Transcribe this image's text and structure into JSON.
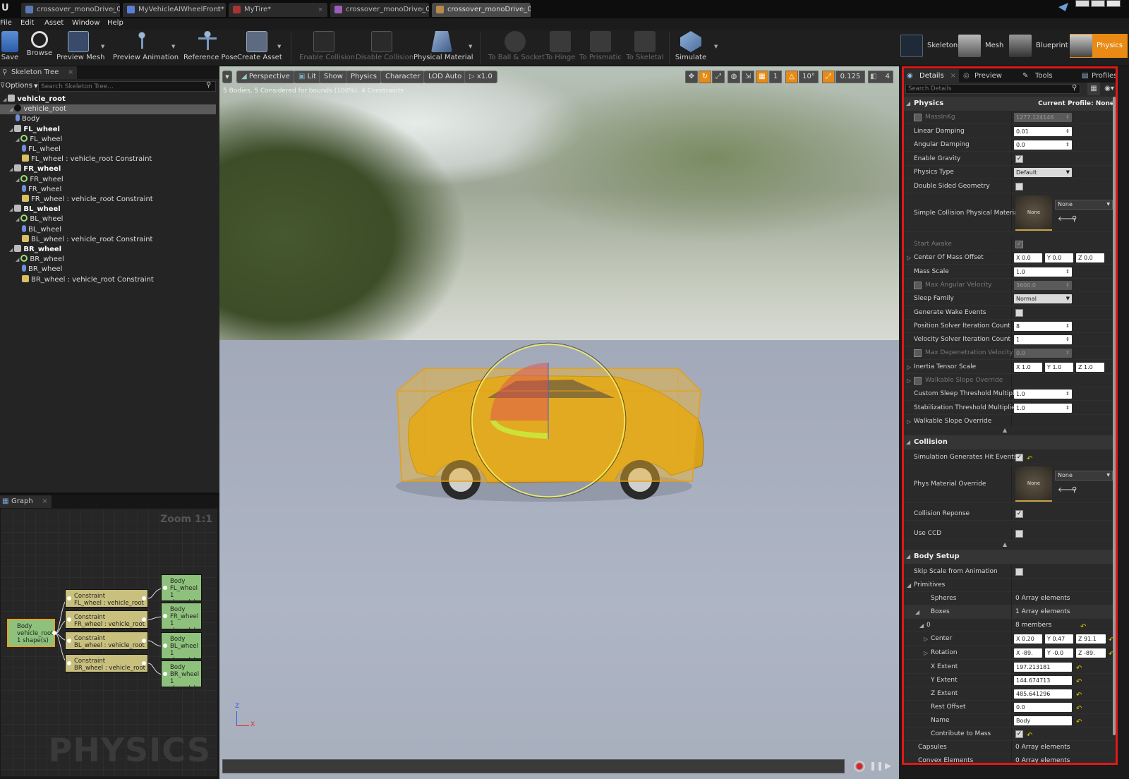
{
  "tabs": [
    {
      "label": "crossover_monoDrive_01",
      "color": "#5a7ab5"
    },
    {
      "label": "MyVehicleAIWheelFront*",
      "color": "#5b7fd8"
    },
    {
      "label": "MyTire*",
      "color": "#a33"
    },
    {
      "label": "crossover_monoDrive_01",
      "color": "#9b5fb5"
    },
    {
      "label": "crossover_monoDrive_01*",
      "color": "#b58a4a"
    }
  ],
  "menu": [
    "File",
    "Edit",
    "Asset",
    "Window",
    "Help"
  ],
  "toolbar": {
    "save": "Save",
    "browse": "Browse",
    "preview_mesh": "Preview Mesh",
    "preview_animation": "Preview Animation",
    "reference_pose": "Reference Pose",
    "create_asset": "Create Asset",
    "enable_collision": "Enable Collision",
    "disable_collision": "Disable Collision",
    "physical_material": "Physical Material",
    "to_ball_socket": "To Ball & Socket",
    "to_hinge": "To Hinge",
    "to_prismatic": "To Prismatic",
    "to_skeletal": "To Skeletal",
    "simulate": "Simulate"
  },
  "modes": {
    "skeleton": "Skeleton",
    "mesh": "Mesh",
    "blueprint": "Blueprint",
    "physics": "Physics"
  },
  "skeleton_tree": {
    "tab": "Skeleton Tree",
    "options": "Options",
    "search_placeholder": "Search Skeleton Tree...",
    "rows": [
      {
        "label": "vehicle_root",
        "indent": 0,
        "bold": true,
        "icon": "bone-icon"
      },
      {
        "label": "vehicle_root",
        "indent": 1,
        "bold": false,
        "icon": "body-icon",
        "selected": true
      },
      {
        "label": "Body",
        "indent": 2,
        "bold": false,
        "icon": "capsule-icon"
      },
      {
        "label": "FL_wheel",
        "indent": 1,
        "bold": true,
        "icon": "bone-icon"
      },
      {
        "label": "FL_wheel",
        "indent": 2,
        "bold": false,
        "icon": "body-icon"
      },
      {
        "label": "FL_wheel",
        "indent": 3,
        "bold": false,
        "icon": "capsule-icon"
      },
      {
        "label": "FL_wheel : vehicle_root Constraint",
        "indent": 3,
        "bold": false,
        "icon": "constraint-icon"
      },
      {
        "label": "FR_wheel",
        "indent": 1,
        "bold": true,
        "icon": "bone-icon"
      },
      {
        "label": "FR_wheel",
        "indent": 2,
        "bold": false,
        "icon": "body-icon"
      },
      {
        "label": "FR_wheel",
        "indent": 3,
        "bold": false,
        "icon": "capsule-icon"
      },
      {
        "label": "FR_wheel : vehicle_root Constraint",
        "indent": 3,
        "bold": false,
        "icon": "constraint-icon"
      },
      {
        "label": "BL_wheel",
        "indent": 1,
        "bold": true,
        "icon": "bone-icon"
      },
      {
        "label": "BL_wheel",
        "indent": 2,
        "bold": false,
        "icon": "body-icon"
      },
      {
        "label": "BL_wheel",
        "indent": 3,
        "bold": false,
        "icon": "capsule-icon"
      },
      {
        "label": "BL_wheel : vehicle_root Constraint",
        "indent": 3,
        "bold": false,
        "icon": "constraint-icon"
      },
      {
        "label": "BR_wheel",
        "indent": 1,
        "bold": true,
        "icon": "bone-icon"
      },
      {
        "label": "BR_wheel",
        "indent": 2,
        "bold": false,
        "icon": "body-icon"
      },
      {
        "label": "BR_wheel",
        "indent": 3,
        "bold": false,
        "icon": "capsule-icon"
      },
      {
        "label": "BR_wheel : vehicle_root Constraint",
        "indent": 3,
        "bold": false,
        "icon": "constraint-icon"
      }
    ]
  },
  "graph": {
    "tab": "Graph",
    "zoom": "Zoom 1:1",
    "watermark": "PHYSICS",
    "root_node": [
      "Body",
      "vehicle_root",
      "1 shape(s)"
    ],
    "constraints": [
      [
        "Constraint",
        "FL_wheel : vehicle_root"
      ],
      [
        "Constraint",
        "FR_wheel : vehicle_root"
      ],
      [
        "Constraint",
        "BL_wheel : vehicle_root"
      ],
      [
        "Constraint",
        "BR_wheel : vehicle_root"
      ]
    ],
    "bodies": [
      [
        "Body",
        "FL_wheel",
        "1 shape(s)"
      ],
      [
        "Body",
        "FR_wheel",
        "1 shape(s)"
      ],
      [
        "Body",
        "BL_wheel",
        "1 shape(s)"
      ],
      [
        "Body",
        "BR_wheel",
        "1 shape(s)"
      ]
    ]
  },
  "viewport": {
    "perspective": "Perspective",
    "lit": "Lit",
    "show": "Show",
    "physics": "Physics",
    "character": "Character",
    "lod": "LOD Auto",
    "speed": "x1.0",
    "status": "5 Bodies, 5 Considered for bounds (100%), 4 Constraints",
    "grid_snap": "1",
    "angle_snap": "10°",
    "scale_snap": "0.125",
    "cam_speed": "4",
    "axis_z": "Z",
    "axis_x": "X"
  },
  "details": {
    "tabs": [
      "Details",
      "Preview",
      "Tools",
      "Profiles"
    ],
    "search_placeholder": "Search Details",
    "physics_header": "Physics",
    "current_profile": "Current Profile: None",
    "physics_rows": [
      {
        "label": "MassInKg",
        "type": "num",
        "value": "1277.124146",
        "dim": true,
        "check": true
      },
      {
        "label": "Linear Damping",
        "type": "num",
        "value": "0.01"
      },
      {
        "label": "Angular Damping",
        "type": "num",
        "value": "0.0"
      },
      {
        "label": "Enable Gravity",
        "type": "cb",
        "value": "✓"
      },
      {
        "label": "Physics Type",
        "type": "drop",
        "value": "Default"
      },
      {
        "label": "Double Sided Geometry",
        "type": "cb",
        "value": ""
      }
    ],
    "simple_collision_label": "Simple Collision Physical Material",
    "material_none": "None",
    "physics_rows2": [
      {
        "label": "Start Awake",
        "type": "cb",
        "value": "✓",
        "dim": true
      },
      {
        "label": "Center Of Mass Offset",
        "type": "vec",
        "x": "0.0",
        "y": "0.0",
        "z": "0.0",
        "expand": true
      },
      {
        "label": "Mass Scale",
        "type": "num",
        "value": "1.0"
      },
      {
        "label": "Max Angular Velocity",
        "type": "num",
        "value": "3600.0",
        "dim": true,
        "check": true
      },
      {
        "label": "Sleep Family",
        "type": "drop",
        "value": "Normal"
      },
      {
        "label": "Generate Wake Events",
        "type": "cb",
        "value": ""
      },
      {
        "label": "Position Solver Iteration Count",
        "type": "num",
        "value": "8"
      },
      {
        "label": "Velocity Solver Iteration Count",
        "type": "num",
        "value": "1"
      },
      {
        "label": "Max Depenetration Velocity",
        "type": "num",
        "value": "0.0",
        "dim": true,
        "check": true
      },
      {
        "label": "Inertia Tensor Scale",
        "type": "vec",
        "x": "1.0",
        "y": "1.0",
        "z": "1.0",
        "expand": true
      },
      {
        "label": "Walkable Slope Override",
        "type": "none",
        "dim": true,
        "check": true,
        "expand": true
      },
      {
        "label": "Custom Sleep Threshold Multiplier",
        "type": "num",
        "value": "1.0"
      },
      {
        "label": "Stabilization Threshold Multiplier",
        "type": "num",
        "value": "1.0"
      },
      {
        "label": "Walkable Slope Override",
        "type": "none",
        "expand": true
      }
    ],
    "collision_header": "Collision",
    "sim_hit_label": "Simulation Generates Hit Events",
    "phys_override_label": "Phys Material Override",
    "collision_response_label": "Collision Reponse",
    "use_ccd_label": "Use CCD",
    "body_setup_header": "Body Setup",
    "skip_scale_label": "Skip Scale from Animation",
    "primitives_label": "Primitives",
    "spheres_label": "Spheres",
    "spheres_value": "0 Array elements",
    "boxes_label": "Boxes",
    "boxes_value": "1 Array elements",
    "index0_label": "0",
    "index0_value": "8 members",
    "center_label": "Center",
    "center": {
      "x": "0.20",
      "y": "0.47",
      "z": "91.1"
    },
    "rotation_label": "Rotation",
    "rotation": {
      "x": "-89.",
      "y": "-0.0",
      "z": "-89."
    },
    "x_extent_label": "X Extent",
    "x_extent": "197.213181",
    "y_extent_label": "Y Extent",
    "y_extent": "144.674713",
    "z_extent_label": "Z Extent",
    "z_extent": "485.641296",
    "rest_offset_label": "Rest Offset",
    "rest_offset": "0.0",
    "name_label": "Name",
    "name_value": "Body",
    "contribute_label": "Contribute to Mass",
    "capsules_label": "Capsules",
    "capsules_value": "0 Array elements",
    "convex_label": "Convex Elements",
    "convex_value": "0 Array elements"
  },
  "colors": {
    "highlight": "#e01818",
    "physics_mode": "#e88a14",
    "selection_fill": "#f0b428"
  }
}
